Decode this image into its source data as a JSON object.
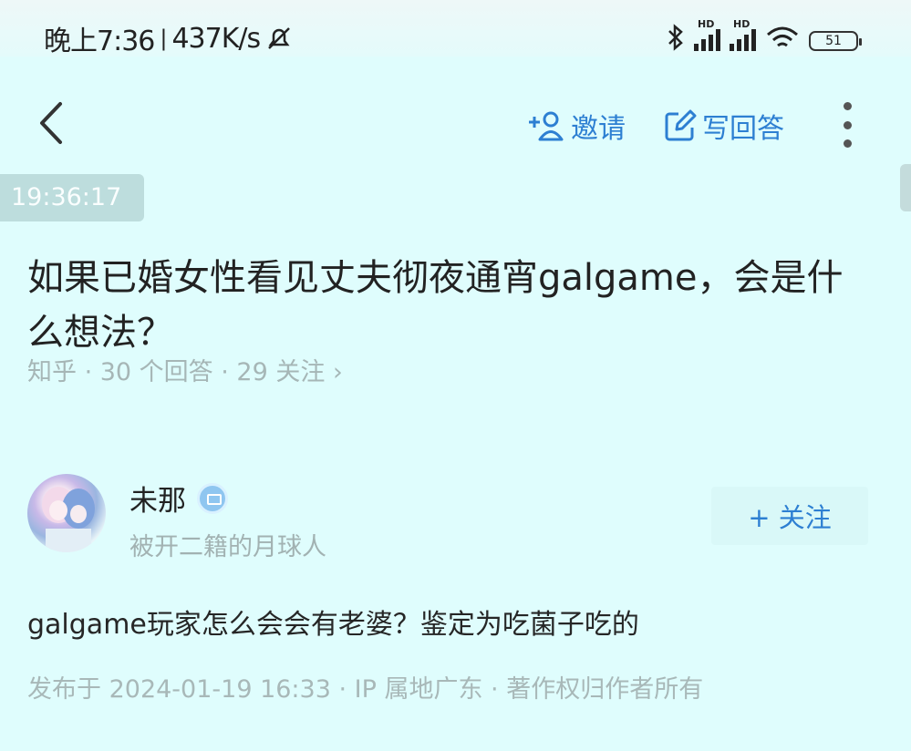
{
  "status_bar": {
    "time": "晚上7:36",
    "net_speed": "437K/s",
    "signal_1_tag": "HD",
    "signal_2_tag": "HD",
    "battery": "51"
  },
  "toolbar": {
    "invite_label": "邀请",
    "write_answer_label": "写回答"
  },
  "time_badge": "19:36:17",
  "question": {
    "title": "如果已婚女性看见丈夫彻夜通宵galgame，会是什么想法？",
    "meta": "知乎 · 30 个回答 · 29 关注 ›"
  },
  "author": {
    "name": "未那",
    "bio": "被开二籍的月球人",
    "follow_label": "+ 关注"
  },
  "answer": {
    "content": "galgame玩家怎么会会有老婆？鉴定为吃菌子吃的",
    "footer": "发布于 2024-01-19 16:33 · IP 属地广东 · 著作权归作者所有"
  },
  "colors": {
    "background": "#dffdfd",
    "accent": "#2d7fd2",
    "muted_text": "#a6b6b6"
  }
}
